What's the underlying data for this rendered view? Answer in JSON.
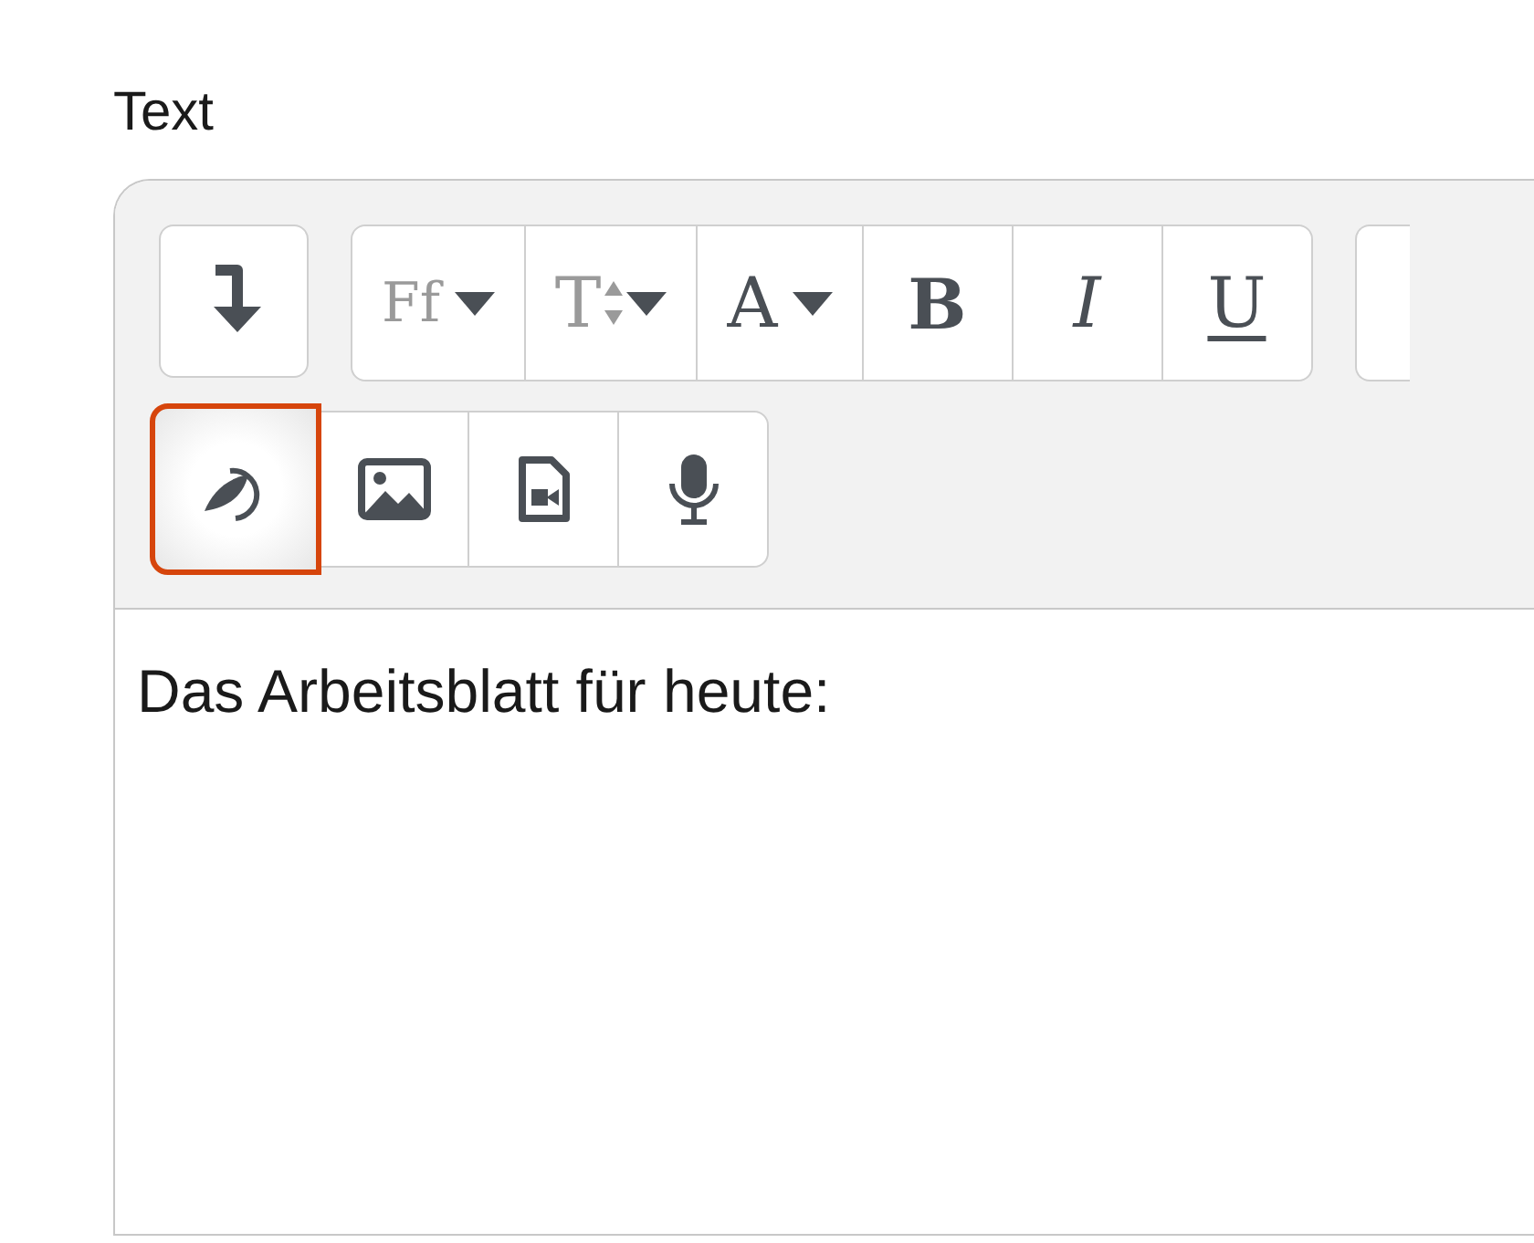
{
  "field_label": "Text",
  "toolbar": [
    {
      "buttons": [
        {
          "kind": "linebreak",
          "highlighted": false,
          "disabled": false
        }
      ]
    },
    {
      "buttons": [
        {
          "kind": "font",
          "label": "Ff",
          "dropdown": true,
          "highlighted": false,
          "disabled": true
        },
        {
          "kind": "size",
          "label": "T",
          "dropdown": true,
          "highlighted": false,
          "disabled": true
        },
        {
          "kind": "color",
          "label": "A",
          "dropdown": true,
          "highlighted": false,
          "disabled": false
        },
        {
          "kind": "bold",
          "label": "B",
          "dropdown": false,
          "highlighted": false,
          "disabled": false
        },
        {
          "kind": "italic",
          "label": "I",
          "dropdown": false,
          "highlighted": false,
          "disabled": false
        },
        {
          "kind": "underline",
          "label": "U",
          "dropdown": false,
          "highlighted": false,
          "disabled": false
        }
      ]
    },
    {
      "row_break": true,
      "buttons": [
        {
          "kind": "media",
          "highlighted": true,
          "disabled": false
        },
        {
          "kind": "image",
          "highlighted": false,
          "disabled": false
        },
        {
          "kind": "video",
          "highlighted": false,
          "disabled": false
        },
        {
          "kind": "audio",
          "highlighted": false,
          "disabled": false
        }
      ]
    }
  ],
  "content": "Das Arbeitsblatt für heute:"
}
